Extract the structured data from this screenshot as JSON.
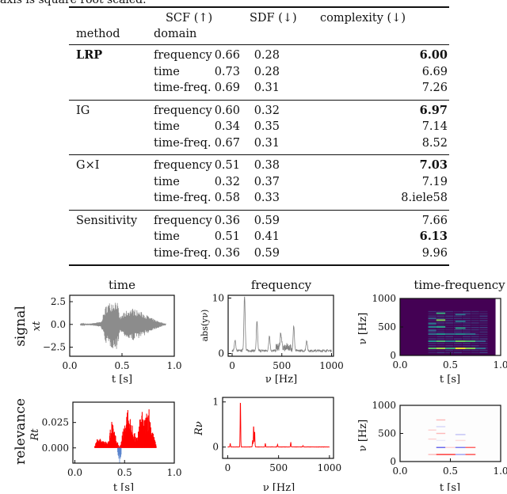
{
  "caption_fragment": "axis is square root scaled.",
  "table": {
    "headers": {
      "method": "method",
      "domain": "domain",
      "scf": "SCF (↑)",
      "sdf": "SDF (↓)",
      "complexity": "complexity (↓)"
    },
    "groups": [
      {
        "method": "LRP",
        "method_bold": true,
        "rows": [
          {
            "domain": "frequency",
            "scf": "0.66",
            "sdf": "0.28",
            "complexity": "6.00",
            "complexity_bold": true
          },
          {
            "domain": "time",
            "scf": "0.73",
            "sdf": "0.28",
            "complexity": "6.69",
            "complexity_bold": false
          },
          {
            "domain": "time-freq.",
            "scf": "0.69",
            "sdf": "0.31",
            "complexity": "7.26",
            "complexity_bold": false
          }
        ]
      },
      {
        "method": "IG",
        "method_bold": false,
        "rows": [
          {
            "domain": "frequency",
            "scf": "0.60",
            "sdf": "0.32",
            "complexity": "6.97",
            "complexity_bold": true
          },
          {
            "domain": "time",
            "scf": "0.34",
            "sdf": "0.35",
            "complexity": "7.14",
            "complexity_bold": false
          },
          {
            "domain": "time-freq.",
            "scf": "0.67",
            "sdf": "0.31",
            "complexity": "8.52",
            "complexity_bold": false
          }
        ]
      },
      {
        "method": "G×I",
        "method_bold": false,
        "rows": [
          {
            "domain": "frequency",
            "scf": "0.51",
            "sdf": "0.38",
            "complexity": "7.03",
            "complexity_bold": true
          },
          {
            "domain": "time",
            "scf": "0.32",
            "sdf": "0.37",
            "complexity": "7.19",
            "complexity_bold": false
          },
          {
            "domain": "time-freq.",
            "scf": "0.58",
            "sdf": "0.33",
            "complexity": "8.iele58",
            "complexity_bold": false
          }
        ]
      },
      {
        "method": "Sensitivity",
        "method_bold": false,
        "rows": [
          {
            "domain": "frequency",
            "scf": "0.36",
            "sdf": "0.59",
            "complexity": "7.66",
            "complexity_bold": false
          },
          {
            "domain": "time",
            "scf": "0.51",
            "sdf": "0.41",
            "complexity": "6.13",
            "complexity_bold": true
          },
          {
            "domain": "time-freq.",
            "scf": "0.36",
            "sdf": "0.59",
            "complexity": "9.96",
            "complexity_bold": false
          }
        ]
      }
    ]
  },
  "figure": {
    "column_titles": [
      "time",
      "frequency",
      "time-frequency"
    ],
    "row_labels": [
      "signal",
      "relevance"
    ],
    "colors": {
      "signal": "#808080",
      "relevance_pos": "#ff0000",
      "relevance_neg": "#4a78c8",
      "spectrogram_bg": "#440154",
      "spectrogram_mid": "#3b528b",
      "spectrogram_teal": "#21918c",
      "spectrogram_green": "#5ec962",
      "spectrogram_yellow": "#fde725"
    }
  },
  "chart_data": [
    {
      "id": "signal-time",
      "type": "line",
      "title": "time",
      "xlabel": "t [s]",
      "ylabel": "x_t",
      "xlim": [
        0.0,
        1.0
      ],
      "ylim": [
        -3.5,
        3.2
      ],
      "xticks": [
        "0.0",
        "0.5",
        "1.0"
      ],
      "yticks": [
        "2.5",
        "0.0",
        "−2.5"
      ],
      "ytick_values": [
        2.5,
        0.0,
        -2.5
      ],
      "xtick_values": [
        0.0,
        0.5,
        1.0
      ],
      "envelope": [
        {
          "t": 0.1,
          "amp": 0.05
        },
        {
          "t": 0.2,
          "amp": 0.1
        },
        {
          "t": 0.3,
          "amp": 0.3
        },
        {
          "t": 0.35,
          "amp": 2.2
        },
        {
          "t": 0.4,
          "amp": 2.6
        },
        {
          "t": 0.45,
          "amp": 2.8
        },
        {
          "t": 0.48,
          "amp": 0.8
        },
        {
          "t": 0.55,
          "amp": 1.6
        },
        {
          "t": 0.6,
          "amp": 1.8
        },
        {
          "t": 0.7,
          "amp": 1.3
        },
        {
          "t": 0.8,
          "amp": 0.6
        },
        {
          "t": 0.92,
          "amp": 0.05
        }
      ]
    },
    {
      "id": "signal-frequency",
      "type": "line",
      "title": "frequency",
      "xlabel": "ν [Hz]",
      "ylabel": "abs(y_ν)",
      "xlim": [
        -40,
        1020
      ],
      "ylim": [
        -0.5,
        10.5
      ],
      "xticks": [
        "0",
        "500",
        "1000"
      ],
      "xtick_values": [
        0,
        500,
        1000
      ],
      "yticks": [
        "10",
        "0"
      ],
      "ytick_values": [
        10,
        0
      ],
      "peaks": [
        {
          "nu": 30,
          "value": 2.0
        },
        {
          "nu": 125,
          "value": 10.0
        },
        {
          "nu": 250,
          "value": 5.3
        },
        {
          "nu": 375,
          "value": 2.8
        },
        {
          "nu": 490,
          "value": 2.6
        },
        {
          "nu": 620,
          "value": 4.5
        },
        {
          "nu": 750,
          "value": 1.9
        }
      ]
    },
    {
      "id": "signal-time-frequency",
      "type": "heatmap",
      "title": "time-frequency",
      "xlabel": "t [s]",
      "ylabel": "ν [Hz]",
      "xlim": [
        0.0,
        1.0
      ],
      "ylim": [
        0,
        1000
      ],
      "xticks": [
        "0.0",
        "0.5",
        "1.0"
      ],
      "xtick_values": [
        0.0,
        0.5,
        1.0
      ],
      "yticks": [
        "1000",
        "500",
        "0"
      ],
      "ytick_values": [
        1000,
        500,
        0
      ],
      "cells": [
        {
          "t0": 0.28,
          "t1": 0.36,
          "nu": 125,
          "v": 0.7
        },
        {
          "t0": 0.36,
          "t1": 0.45,
          "nu": 125,
          "v": 0.85
        },
        {
          "t0": 0.45,
          "t1": 0.55,
          "nu": 125,
          "v": 0.6
        },
        {
          "t0": 0.55,
          "t1": 0.65,
          "nu": 125,
          "v": 0.95
        },
        {
          "t0": 0.65,
          "t1": 0.75,
          "nu": 125,
          "v": 0.8
        },
        {
          "t0": 0.75,
          "t1": 0.85,
          "nu": 125,
          "v": 0.35
        },
        {
          "t0": 0.28,
          "t1": 0.36,
          "nu": 250,
          "v": 0.5
        },
        {
          "t0": 0.36,
          "t1": 0.45,
          "nu": 250,
          "v": 0.65
        },
        {
          "t0": 0.45,
          "t1": 0.55,
          "nu": 250,
          "v": 0.45
        },
        {
          "t0": 0.55,
          "t1": 0.65,
          "nu": 250,
          "v": 0.75
        },
        {
          "t0": 0.65,
          "t1": 0.75,
          "nu": 250,
          "v": 0.65
        },
        {
          "t0": 0.75,
          "t1": 0.85,
          "nu": 250,
          "v": 0.3
        },
        {
          "t0": 0.28,
          "t1": 0.36,
          "nu": 375,
          "v": 0.35
        },
        {
          "t0": 0.36,
          "t1": 0.45,
          "nu": 375,
          "v": 0.5
        },
        {
          "t0": 0.45,
          "t1": 0.55,
          "nu": 375,
          "v": 0.35
        },
        {
          "t0": 0.55,
          "t1": 0.65,
          "nu": 375,
          "v": 0.45
        },
        {
          "t0": 0.65,
          "t1": 0.75,
          "nu": 375,
          "v": 0.35
        },
        {
          "t0": 0.28,
          "t1": 0.36,
          "nu": 500,
          "v": 0.45
        },
        {
          "t0": 0.36,
          "t1": 0.45,
          "nu": 500,
          "v": 0.55
        },
        {
          "t0": 0.55,
          "t1": 0.65,
          "nu": 480,
          "v": 0.55
        },
        {
          "t0": 0.28,
          "t1": 0.36,
          "nu": 560,
          "v": 0.4
        },
        {
          "t0": 0.36,
          "t1": 0.45,
          "nu": 620,
          "v": 0.8
        },
        {
          "t0": 0.55,
          "t1": 0.65,
          "nu": 600,
          "v": 0.4
        },
        {
          "t0": 0.36,
          "t1": 0.45,
          "nu": 740,
          "v": 0.6
        },
        {
          "t0": 0.55,
          "t1": 0.65,
          "nu": 720,
          "v": 0.35
        },
        {
          "t0": 0.28,
          "t1": 0.36,
          "nu": 440,
          "v": 0.3
        },
        {
          "t0": 0.28,
          "t1": 0.36,
          "nu": 650,
          "v": 0.3
        }
      ]
    },
    {
      "id": "relevance-time",
      "type": "bar",
      "xlabel": "t [s]",
      "ylabel": "R_t",
      "xlim": [
        -0.02,
        1.0
      ],
      "ylim": [
        -0.015,
        0.045
      ],
      "xticks": [
        "0.0",
        "0.5",
        "1.0"
      ],
      "xtick_values": [
        0.0,
        0.5,
        1.0
      ],
      "yticks": [
        "0.025",
        "0.000"
      ],
      "ytick_values": [
        0.025,
        0.0
      ],
      "positive_envelope": [
        {
          "t": 0.2,
          "v": 0.002
        },
        {
          "t": 0.23,
          "v": 0.011
        },
        {
          "t": 0.28,
          "v": 0.007
        },
        {
          "t": 0.33,
          "v": 0.006
        },
        {
          "t": 0.37,
          "v": 0.028
        },
        {
          "t": 0.4,
          "v": 0.015
        },
        {
          "t": 0.45,
          "v": 0.0
        },
        {
          "t": 0.5,
          "v": 0.027
        },
        {
          "t": 0.53,
          "v": 0.041
        },
        {
          "t": 0.57,
          "v": 0.025
        },
        {
          "t": 0.62,
          "v": 0.009
        },
        {
          "t": 0.67,
          "v": 0.038
        },
        {
          "t": 0.7,
          "v": 0.028
        },
        {
          "t": 0.74,
          "v": 0.046
        },
        {
          "t": 0.78,
          "v": 0.018
        },
        {
          "t": 0.82,
          "v": 0.002
        }
      ],
      "negative_envelope": [
        {
          "t": 0.43,
          "v": -0.008
        },
        {
          "t": 0.45,
          "v": -0.016
        },
        {
          "t": 0.47,
          "v": -0.006
        }
      ]
    },
    {
      "id": "relevance-frequency",
      "type": "line",
      "xlabel": "ν [Hz]",
      "ylabel": "R_ν",
      "xlim": [
        -50,
        1040
      ],
      "ylim": [
        -0.25,
        1.1
      ],
      "xticks": [
        "0",
        "500",
        "1000"
      ],
      "xtick_values": [
        0,
        500,
        1000
      ],
      "yticks": [
        "1",
        "0"
      ],
      "ytick_values": [
        1,
        0
      ],
      "peaks": [
        {
          "nu": 25,
          "value": 0.08
        },
        {
          "nu": 125,
          "value": 1.05
        },
        {
          "nu": 245,
          "value": 0.15
        },
        {
          "nu": 255,
          "value": 0.48
        },
        {
          "nu": 265,
          "value": 0.35
        },
        {
          "nu": 370,
          "value": 0.08
        },
        {
          "nu": 490,
          "value": 0.06
        },
        {
          "nu": 620,
          "value": 0.11
        },
        {
          "nu": 740,
          "value": 0.03
        }
      ]
    },
    {
      "id": "relevance-time-frequency",
      "type": "heatmap",
      "xlabel": "t [s]",
      "ylabel": "ν [Hz]",
      "xlim": [
        0.0,
        1.0
      ],
      "ylim": [
        0,
        1000
      ],
      "xticks": [
        "0.0",
        "0.5",
        "1.0"
      ],
      "xtick_values": [
        0.0,
        0.5,
        1.0
      ],
      "yticks": [
        "1000",
        "500",
        "0"
      ],
      "ytick_values": [
        1000,
        500,
        0
      ],
      "cells": [
        {
          "t0": 0.36,
          "t1": 0.55,
          "nu": 125,
          "v": 0.9
        },
        {
          "t0": 0.55,
          "t1": 0.65,
          "nu": 125,
          "v": -0.5
        },
        {
          "t0": 0.65,
          "t1": 0.75,
          "nu": 125,
          "v": 0.8
        },
        {
          "t0": 0.28,
          "t1": 0.36,
          "nu": 125,
          "v": 0.3
        },
        {
          "t0": 0.36,
          "t1": 0.45,
          "nu": 250,
          "v": -0.8
        },
        {
          "t0": 0.45,
          "t1": 0.55,
          "nu": 250,
          "v": 0.2
        },
        {
          "t0": 0.55,
          "t1": 0.65,
          "nu": 250,
          "v": -0.7
        },
        {
          "t0": 0.65,
          "t1": 0.75,
          "nu": 250,
          "v": 0.7
        },
        {
          "t0": 0.36,
          "t1": 0.45,
          "nu": 500,
          "v": 0.3
        },
        {
          "t0": 0.55,
          "t1": 0.65,
          "nu": 480,
          "v": -0.3
        },
        {
          "t0": 0.36,
          "t1": 0.45,
          "nu": 620,
          "v": -0.2
        },
        {
          "t0": 0.36,
          "t1": 0.45,
          "nu": 740,
          "v": 0.3
        },
        {
          "t0": 0.28,
          "t1": 0.36,
          "nu": 400,
          "v": 0.2
        },
        {
          "t0": 0.28,
          "t1": 0.36,
          "nu": 560,
          "v": 0.2
        },
        {
          "t0": 0.36,
          "t1": 0.45,
          "nu": 375,
          "v": -0.1
        },
        {
          "t0": 0.55,
          "t1": 0.65,
          "nu": 375,
          "v": 0.15
        }
      ]
    }
  ]
}
